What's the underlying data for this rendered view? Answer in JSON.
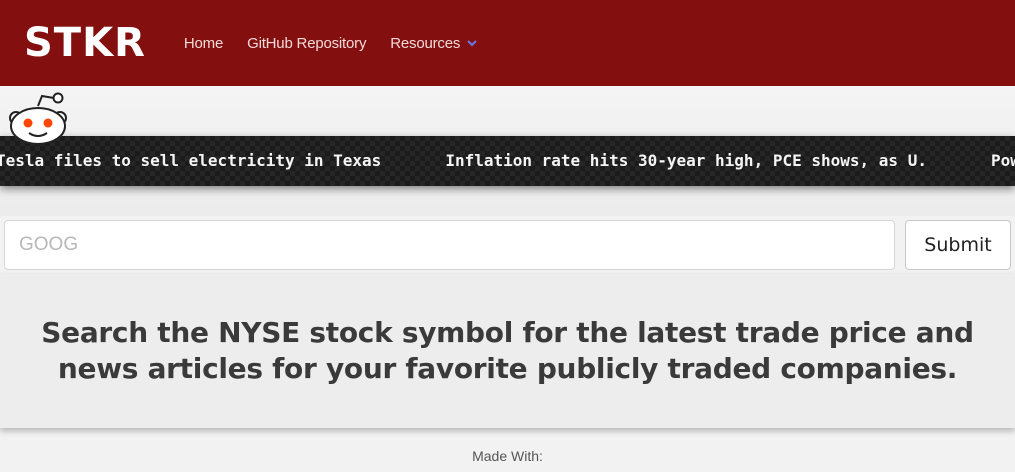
{
  "navbar": {
    "brand": "STKR",
    "links": [
      {
        "label": "Home"
      },
      {
        "label": "GitHub Repository"
      },
      {
        "label": "Resources"
      }
    ]
  },
  "ticker": {
    "headlines": [
      "Tesla files to sell electricity in Texas",
      "Inflation rate hits 30-year high, PCE shows, as U.",
      "Powell-Signa"
    ]
  },
  "search": {
    "placeholder": "GOOG",
    "submit_label": "Submit"
  },
  "hero": {
    "text": "Search the NYSE stock symbol for the latest trade price and news articles for your favorite publicly traded companies."
  },
  "footer": {
    "made_with": "Made With:"
  },
  "colors": {
    "navbar_bg": "#83100f",
    "reddit_orange": "#ff4500"
  }
}
